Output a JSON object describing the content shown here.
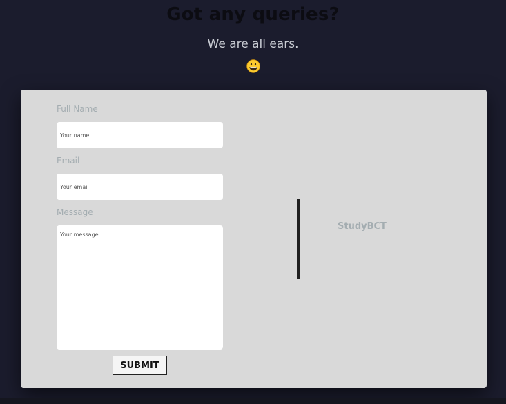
{
  "header": {
    "title": "Got any queries?",
    "subtitle": "We are all ears.",
    "emoji_icon": "grinning-face-emoji"
  },
  "form": {
    "name_label": "Full Name",
    "name_placeholder": "Your name",
    "email_label": "Email",
    "email_placeholder": "Your email",
    "message_label": "Message",
    "message_placeholder": "Your message",
    "submit_label": "SUBMIT"
  },
  "brand": {
    "name": "StudyBCT"
  },
  "colors": {
    "page_background": "#1b1c2d",
    "card_background": "#d9d9d9",
    "label_color": "#a4adb1",
    "divider_color": "#1f1f1f"
  }
}
